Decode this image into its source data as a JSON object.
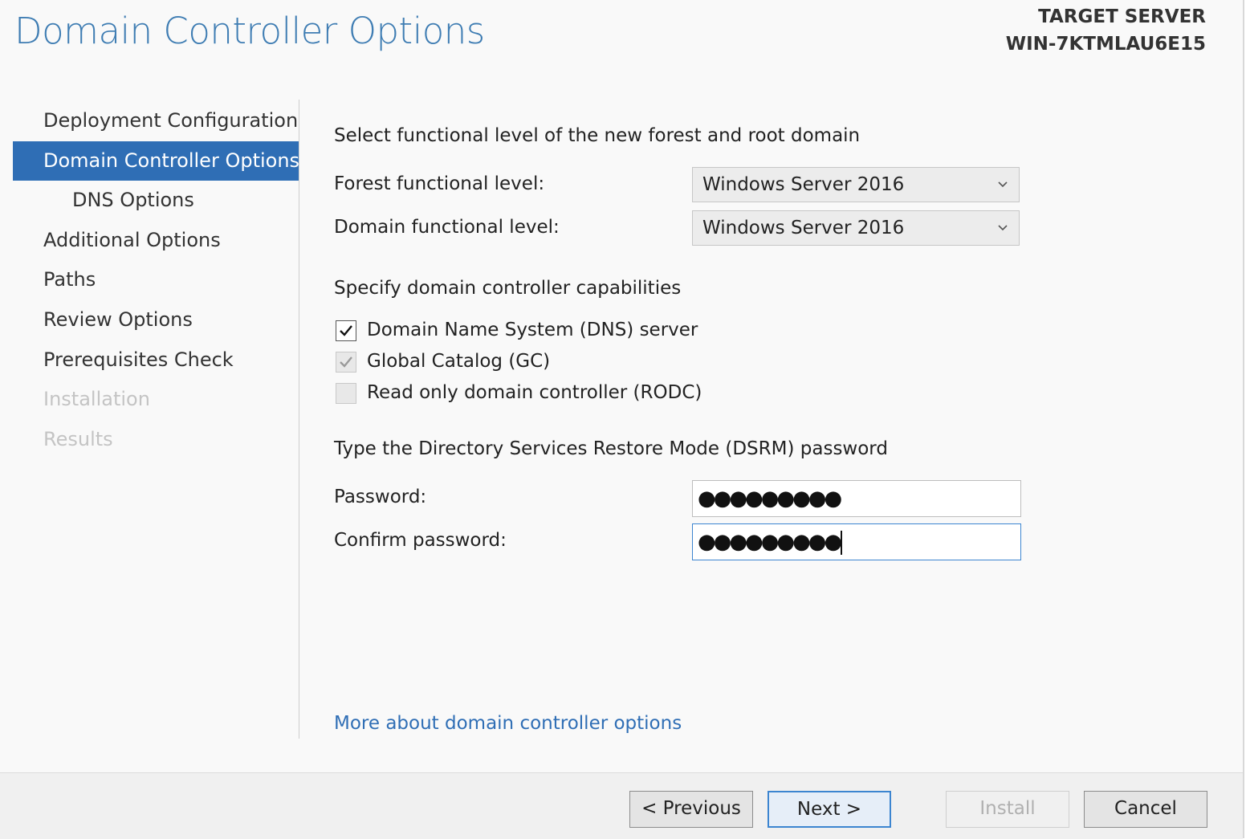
{
  "header": {
    "title": "Domain Controller Options",
    "target_label": "TARGET SERVER",
    "target_name": "WIN-7KTMLAU6E15"
  },
  "nav": {
    "items": [
      {
        "label": "Deployment Configuration",
        "state": "normal"
      },
      {
        "label": "Domain Controller Options",
        "state": "active"
      },
      {
        "label": "DNS Options",
        "state": "sub"
      },
      {
        "label": "Additional Options",
        "state": "normal"
      },
      {
        "label": "Paths",
        "state": "normal"
      },
      {
        "label": "Review Options",
        "state": "normal"
      },
      {
        "label": "Prerequisites Check",
        "state": "normal"
      },
      {
        "label": "Installation",
        "state": "disabled"
      },
      {
        "label": "Results",
        "state": "disabled"
      }
    ]
  },
  "functional": {
    "section_title": "Select functional level of the new forest and root domain",
    "forest_label": "Forest functional level:",
    "forest_value": "Windows Server 2016",
    "domain_label": "Domain functional level:",
    "domain_value": "Windows Server 2016"
  },
  "capabilities": {
    "section_title": "Specify domain controller capabilities",
    "dns": {
      "label": "Domain Name System (DNS) server",
      "checked": true,
      "enabled": true
    },
    "gc": {
      "label": "Global Catalog (GC)",
      "checked": true,
      "enabled": false
    },
    "rodc": {
      "label": "Read only domain controller (RODC)",
      "checked": false,
      "enabled": false
    }
  },
  "dsrm": {
    "section_title": "Type the Directory Services Restore Mode (DSRM) password",
    "password_label": "Password:",
    "password_mask": "●●●●●●●●●",
    "confirm_label": "Confirm password:",
    "confirm_mask": "●●●●●●●●●"
  },
  "more_link": "More about domain controller options",
  "footer": {
    "previous": "< Previous",
    "next": "Next >",
    "install": "Install",
    "cancel": "Cancel"
  },
  "icons": {
    "dropdown": "chevron-down-icon",
    "check": "checkmark-icon"
  }
}
